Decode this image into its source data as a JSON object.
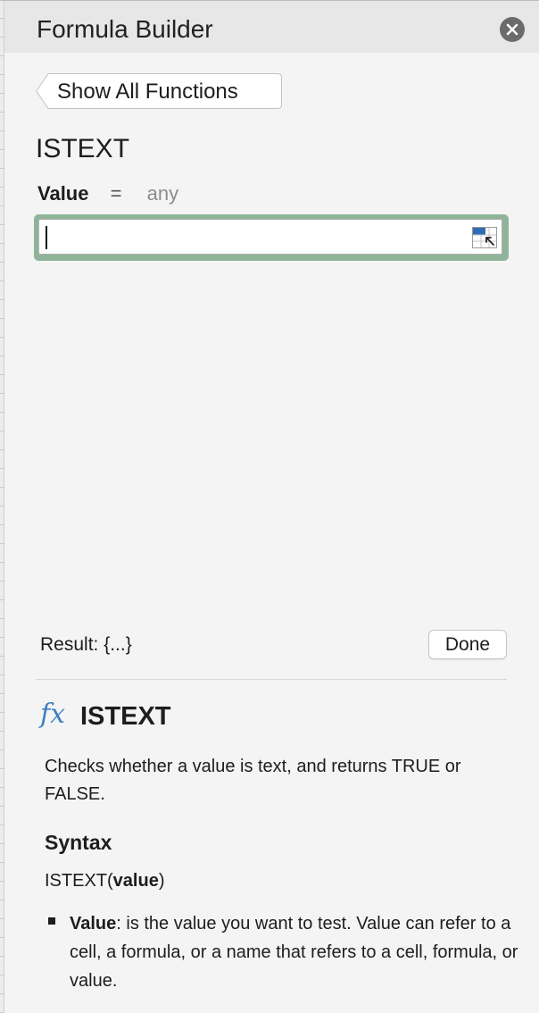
{
  "panel": {
    "title": "Formula Builder",
    "close_icon": "close-icon"
  },
  "navigation": {
    "back_label": "Show All Functions"
  },
  "function": {
    "name": "ISTEXT",
    "argument": {
      "name": "Value",
      "equals": "=",
      "type": "any",
      "input_value": "",
      "picker_icon": "range-select-icon"
    }
  },
  "result": {
    "label": "Result: {...}",
    "done_label": "Done"
  },
  "help": {
    "icon": "fx-icon",
    "icon_glyph": "fx",
    "title": "ISTEXT",
    "description": "Checks whether a value is text, and returns TRUE or FALSE.",
    "syntax_heading": "Syntax",
    "syntax_prefix": "ISTEXT(",
    "syntax_arg": "value",
    "syntax_suffix": ")",
    "arg_name": "Value",
    "arg_description": ": is the value you want to test. Value can refer to a cell, a formula, or a name that refers to a cell, formula, or value."
  },
  "colors": {
    "focus_ring": "#8fb49a",
    "fx_blue": "#3d7fc4",
    "header_bg": "#e7e7e7",
    "panel_bg": "#f4f4f4"
  }
}
